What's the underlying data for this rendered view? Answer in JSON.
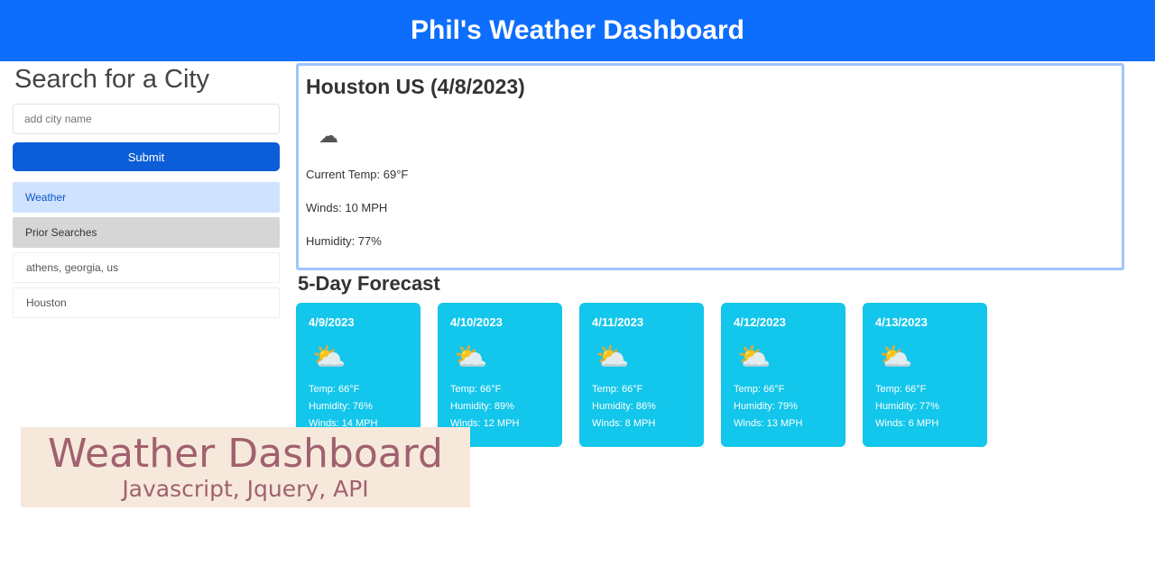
{
  "header": {
    "title": "Phil's Weather Dashboard"
  },
  "sidebar": {
    "title": "Search for a City",
    "search_placeholder": "add city name",
    "submit_label": "Submit",
    "history": [
      {
        "label": "Weather",
        "style": "active"
      },
      {
        "label": "Prior Searches",
        "style": "header"
      },
      {
        "label": "athens, georgia, us",
        "style": "plain"
      },
      {
        "label": "Houston",
        "style": "plain"
      }
    ]
  },
  "current": {
    "title": "Houston US (4/8/2023)",
    "icon": "cloud-icon",
    "temp": "Current Temp: 69°F",
    "wind": "Winds: 10 MPH",
    "humidity": "Humidity: 77%"
  },
  "forecast": {
    "title": "5-Day Forecast",
    "days": [
      {
        "date": "4/9/2023",
        "icon": "partly-cloudy-icon",
        "temp": "Temp: 66°F",
        "humidity": "Humidity: 76%",
        "wind": "Winds: 14 MPH"
      },
      {
        "date": "4/10/2023",
        "icon": "partly-cloudy-icon",
        "temp": "Temp: 66°F",
        "humidity": "Humidity: 89%",
        "wind": "Winds: 12 MPH"
      },
      {
        "date": "4/11/2023",
        "icon": "partly-cloudy-icon",
        "temp": "Temp: 66°F",
        "humidity": "Humidity: 86%",
        "wind": "Winds: 8 MPH"
      },
      {
        "date": "4/12/2023",
        "icon": "partly-cloudy-icon",
        "temp": "Temp: 66°F",
        "humidity": "Humidity: 79%",
        "wind": "Winds: 13 MPH"
      },
      {
        "date": "4/13/2023",
        "icon": "partly-cloudy-icon",
        "temp": "Temp: 66°F",
        "humidity": "Humidity: 77%",
        "wind": "Winds: 6 MPH"
      }
    ]
  },
  "overlay": {
    "title": "Weather Dashboard",
    "subtitle": "Javascript, Jquery, API"
  },
  "colors": {
    "header_bg": "#0d6efd",
    "card_bg": "#13c6eb",
    "overlay_bg": "#f6e9dc",
    "overlay_text": "#a1616f"
  }
}
